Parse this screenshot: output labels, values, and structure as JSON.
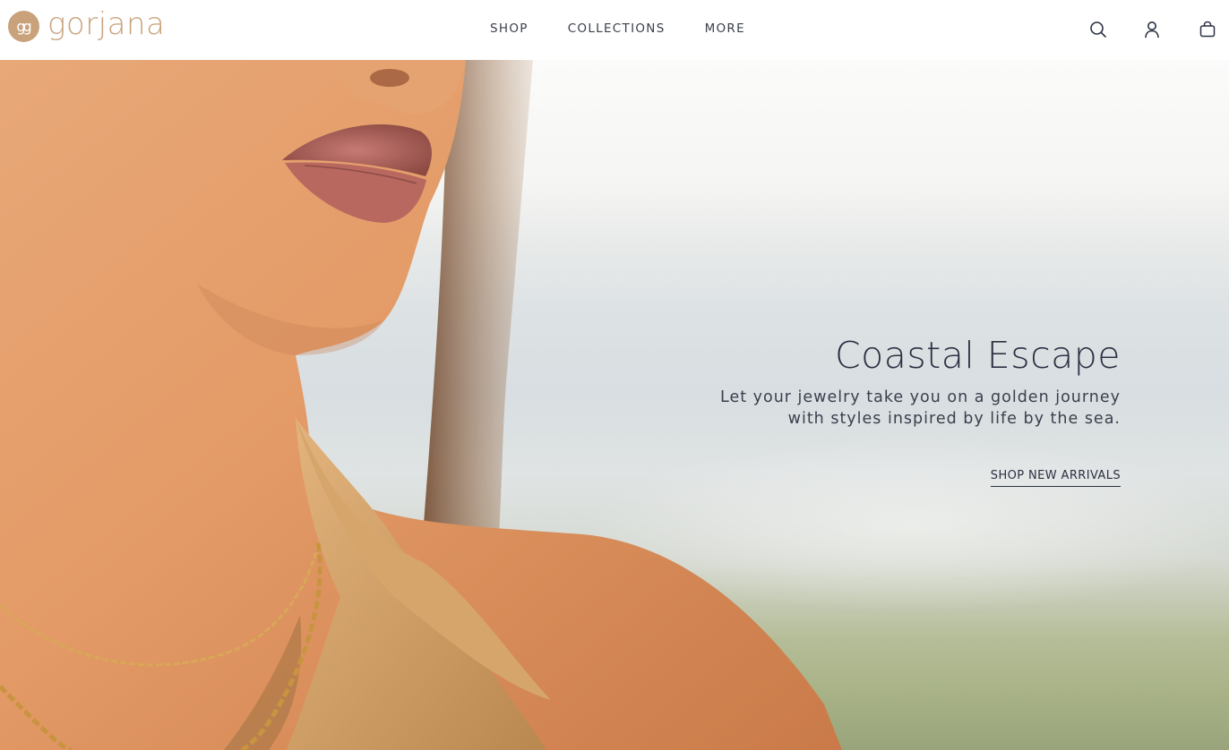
{
  "brand": {
    "name": "gorjana",
    "mark": "gg",
    "color": "#c9a27c"
  },
  "nav": {
    "shop": "SHOP",
    "collections": "COLLECTIONS",
    "more": "MORE"
  },
  "header_icons": [
    "search-icon",
    "account-icon",
    "bag-icon"
  ],
  "hero": {
    "title": "Coastal Escape",
    "subtitle_line1": "Let your jewelry take you on a golden journey",
    "subtitle_line2": "with styles inspired by life by the sea.",
    "cta": "SHOP NEW ARRIVALS",
    "text_color": "#2b3142"
  }
}
